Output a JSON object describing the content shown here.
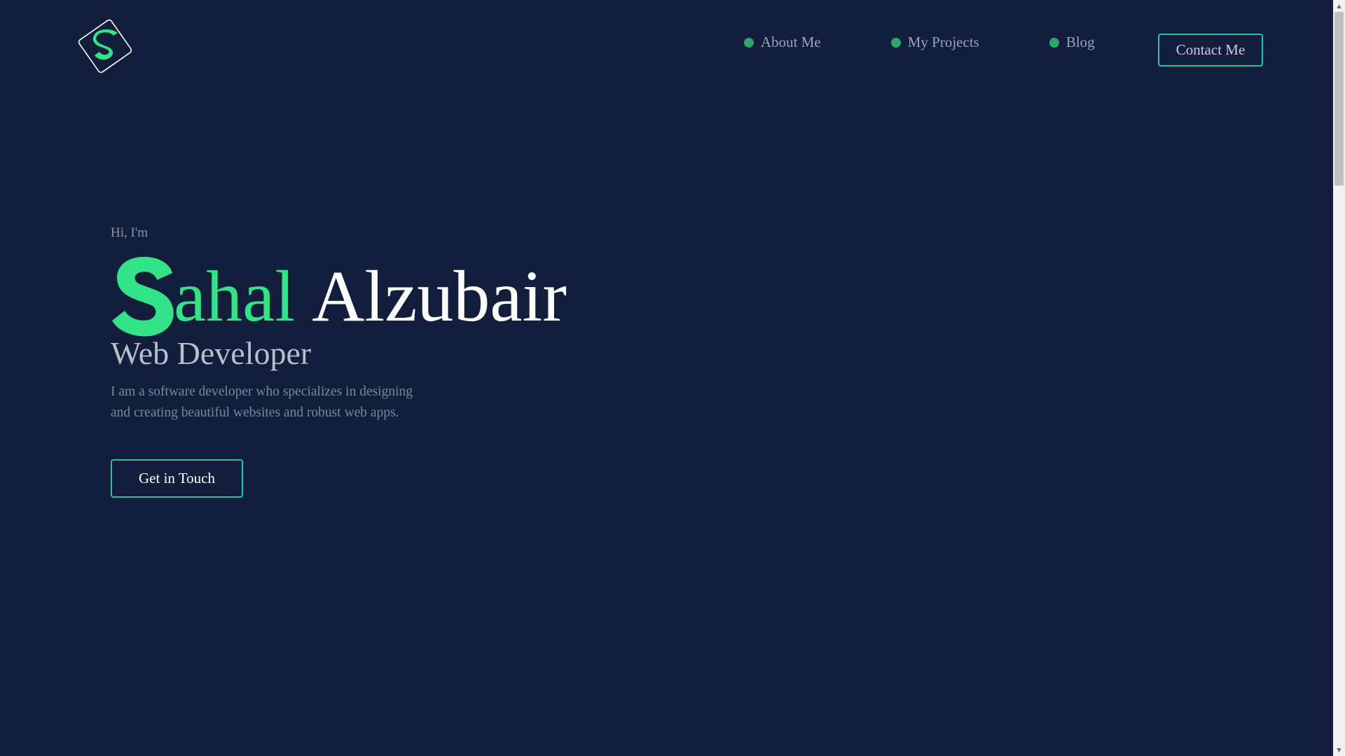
{
  "header": {
    "logo_icon": "s-diamond-logo",
    "nav": [
      {
        "label": "About Me",
        "icon": "dot-icon"
      },
      {
        "label": "My Projects",
        "icon": "dot-icon"
      },
      {
        "label": "Blog",
        "icon": "dot-icon"
      }
    ],
    "contact_label": "Contact Me"
  },
  "hero": {
    "greeting": "Hi, I'm",
    "first_name_rest": "ahal",
    "last_name": "Alzubair",
    "role": "Web Developer",
    "description": "I am a software developer who specializes in designing and creating beautiful websites and robust web apps.",
    "cta_label": "Get in Touch"
  },
  "colors": {
    "background": "#121e3b",
    "accent_green": "#32e487",
    "button_border": "#26c3a0",
    "nav_dot": "#2aa76b"
  }
}
